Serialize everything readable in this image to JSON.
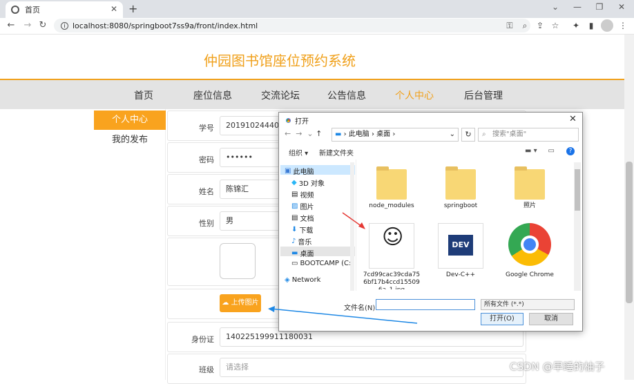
{
  "browser": {
    "tab_title": "首页",
    "url": "localhost:8080/springboot7ss9a/front/index.html"
  },
  "site": {
    "title": "仲园图书馆座位预约系统",
    "nav": [
      "首页",
      "座位信息",
      "交流论坛",
      "公告信息",
      "个人中心",
      "后台管理"
    ],
    "active_nav": "个人中心",
    "accent": "#f0a01a"
  },
  "sidebar": {
    "active": "个人中心",
    "items": [
      "我的发布"
    ]
  },
  "form": {
    "student_id_label": "学号",
    "student_id": "201910244403",
    "password_label": "密码",
    "password": "••••••",
    "name_label": "姓名",
    "name": "陈锦汇",
    "gender_label": "性别",
    "gender": "男",
    "upload_label": "上传图片",
    "id_card_label": "身份证",
    "id_card": "140225199911180031",
    "class_label": "班级",
    "class_placeholder": "请选择"
  },
  "dialog": {
    "title": "打开",
    "path": [
      "此电脑",
      "桌面"
    ],
    "search_placeholder": "搜索\"桌面\"",
    "organize": "组织 ▾",
    "new_folder": "新建文件夹",
    "tree": [
      "此电脑",
      "3D 对象",
      "视频",
      "图片",
      "文档",
      "下载",
      "音乐",
      "桌面",
      "BOOTCAMP (C:",
      "Network"
    ],
    "files": [
      "node_modules",
      "springboot",
      "照片",
      "7cd99cac39cda756bf17b4ccd155096a_1.jpg",
      "Dev-C++",
      "Google Chrome"
    ],
    "file_name_label": "文件名(N):",
    "file_type": "所有文件 (*.*)",
    "open_button": "打开(O)",
    "cancel_button": "取消"
  },
  "watermark": "CSDN @早睡的柚子"
}
